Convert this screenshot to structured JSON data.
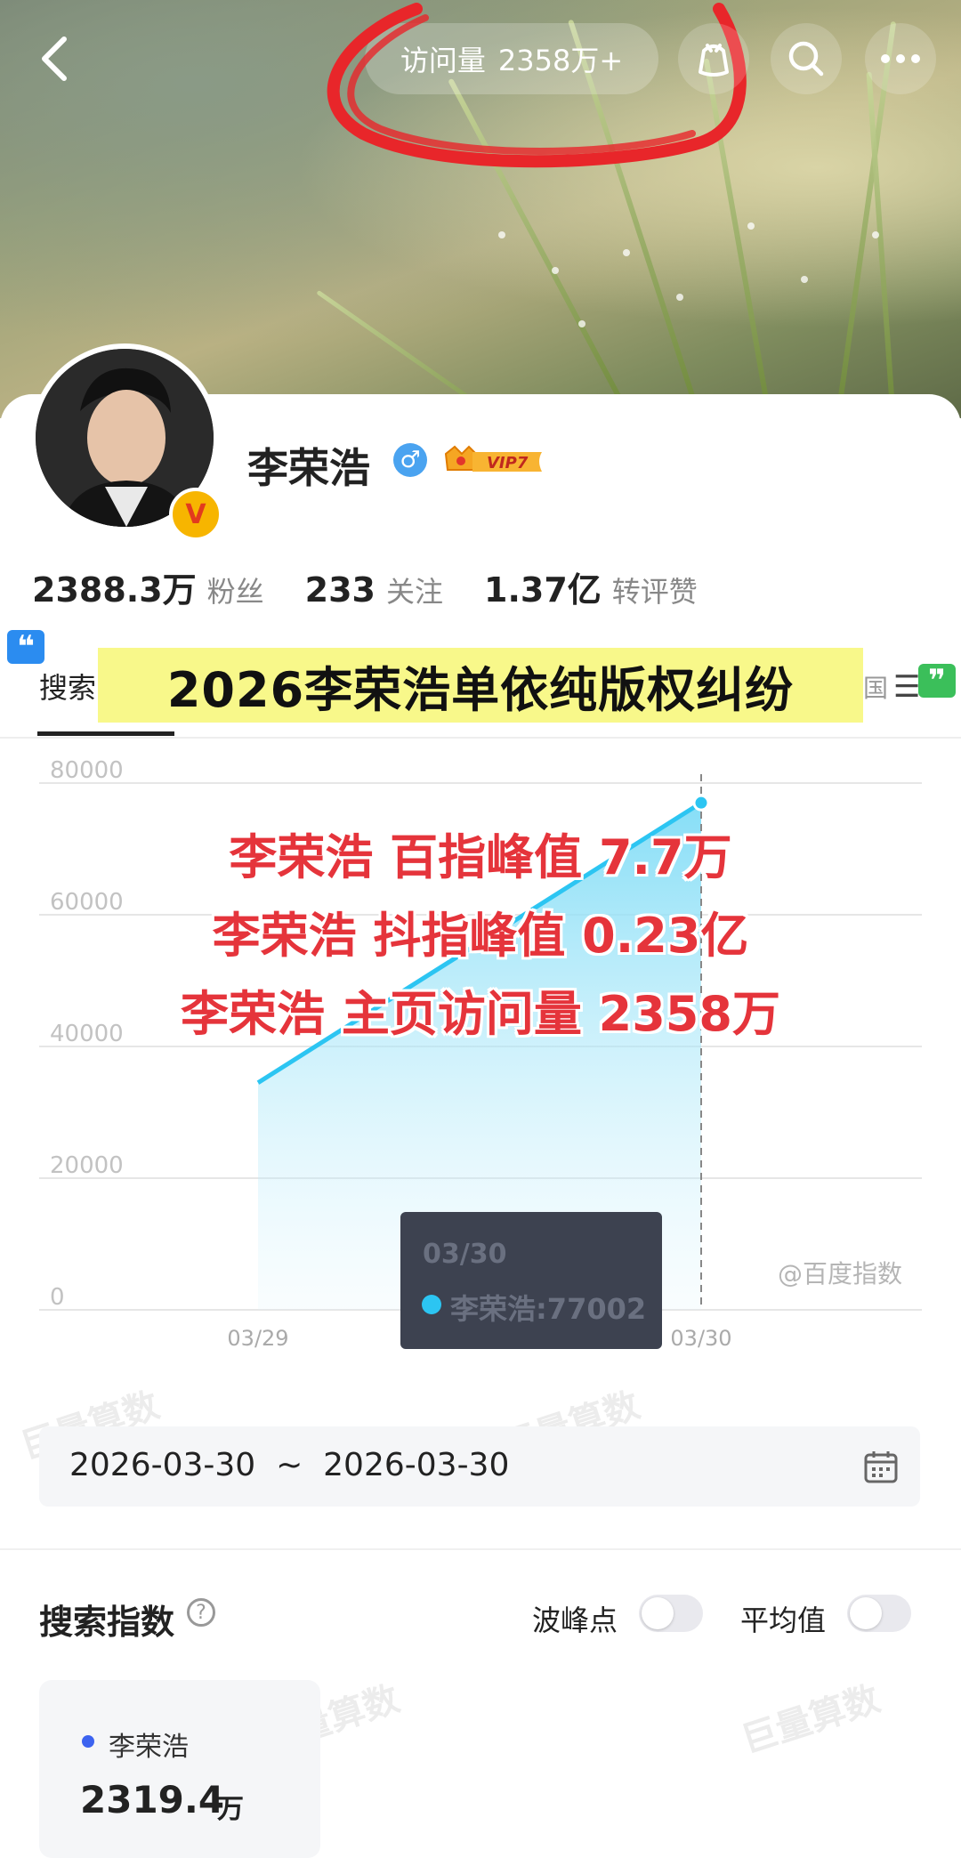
{
  "header": {
    "visit_label": "访问量",
    "visit_count": "2358万+"
  },
  "profile": {
    "name": "李荣浩",
    "vip_level": "VIP7",
    "v_badge": "V",
    "stats": [
      {
        "value": "2388.3万",
        "label": "粉丝"
      },
      {
        "value": "233",
        "label": "关注"
      },
      {
        "value": "1.37亿",
        "label": "转评赞"
      }
    ]
  },
  "tabs": {
    "active": "搜索",
    "right": "国"
  },
  "banner": {
    "text": "2026李荣浩单依纯版权纠纷",
    "quote_left": "❝",
    "quote_right": "❞"
  },
  "overlay": {
    "lines": [
      "李荣浩 百指峰值 7.7万",
      "李荣浩 抖指峰值 0.23亿",
      "李荣浩 主页访问量 2358万"
    ]
  },
  "chart_data": {
    "type": "area",
    "x": [
      "03/29",
      "03/30"
    ],
    "series": [
      {
        "name": "李荣浩",
        "values": [
          34500,
          77002
        ]
      }
    ],
    "yticks": [
      "80000",
      "60000",
      "40000",
      "20000",
      "0"
    ],
    "ylim": [
      0,
      80000
    ],
    "color": "#2cc5f2",
    "tooltip": {
      "date": "03/30",
      "text": "李荣浩:77002"
    },
    "source_watermark": "@百度指数"
  },
  "watermark": "巨量算数",
  "date_range": "2026-03-30  ~  2026-03-30",
  "index_section": {
    "title": "搜索指数",
    "help": "?",
    "peak_label": "波峰点",
    "avg_label": "平均值",
    "keyword": "李荣浩",
    "value": "2319.4",
    "unit": "万"
  }
}
